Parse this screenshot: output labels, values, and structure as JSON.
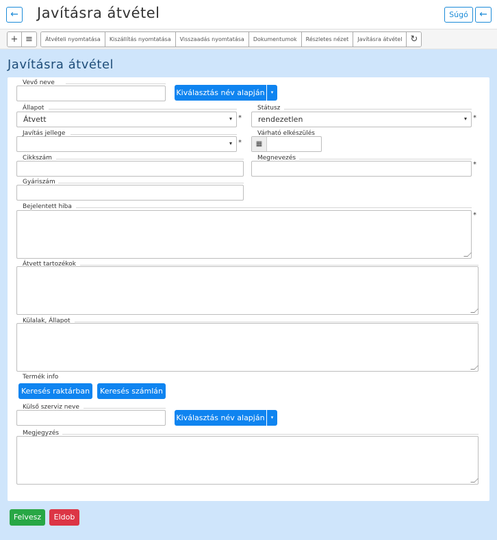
{
  "header": {
    "title": "Javításra átvétel",
    "back_icon": "←",
    "help_label": "Súgó"
  },
  "toolbar": {
    "add_icon": "+",
    "list_icon": "≡",
    "buttons": [
      "Átvételi nyomtatása",
      "Kiszállítás nyomtatása",
      "Visszaadás nyomtatása",
      "Dokumentumok",
      "Részletes nézet",
      "Javításra átvétel"
    ],
    "refresh_icon": "↻"
  },
  "form": {
    "section_title": "Javításra átvétel",
    "customer_name": {
      "label": "Vevő neve",
      "value": ""
    },
    "select_by_name": "Kiválasztás név alapján",
    "caret": "▾",
    "condition": {
      "label": "Állapot",
      "value": "Átvett"
    },
    "status": {
      "label": "Státusz",
      "value": "rendezetlen"
    },
    "repair_type": {
      "label": "Javítás jellege",
      "value": ""
    },
    "expected_completion": {
      "label": "Várható elkészülés",
      "value": ""
    },
    "item_number": {
      "label": "Cikkszám",
      "value": ""
    },
    "name": {
      "label": "Megnevezés",
      "value": ""
    },
    "serial_number": {
      "label": "Gyáriszám",
      "value": ""
    },
    "reported_fault": {
      "label": "Bejelentett hiba"
    },
    "accessories": {
      "label": "Átvett tartozékok"
    },
    "appearance": {
      "label": "Külalak, Állapot"
    },
    "product_info": "Termék info",
    "search_stock": "Keresés raktárban",
    "search_invoice": "Keresés számlán",
    "external_service": {
      "label": "Külső szerviz neve",
      "value": ""
    },
    "note": {
      "label": "Megjegyzés"
    },
    "required_mark": "*",
    "select_arrow": "▾",
    "calendar_icon": "▦"
  },
  "actions": {
    "add": "Felvesz",
    "discard": "Eldob"
  },
  "colors": {
    "primary": "#0f84f0",
    "success": "#28a745",
    "danger": "#dc3545",
    "background": "#cfe5fb",
    "title": "#1f4e79"
  }
}
